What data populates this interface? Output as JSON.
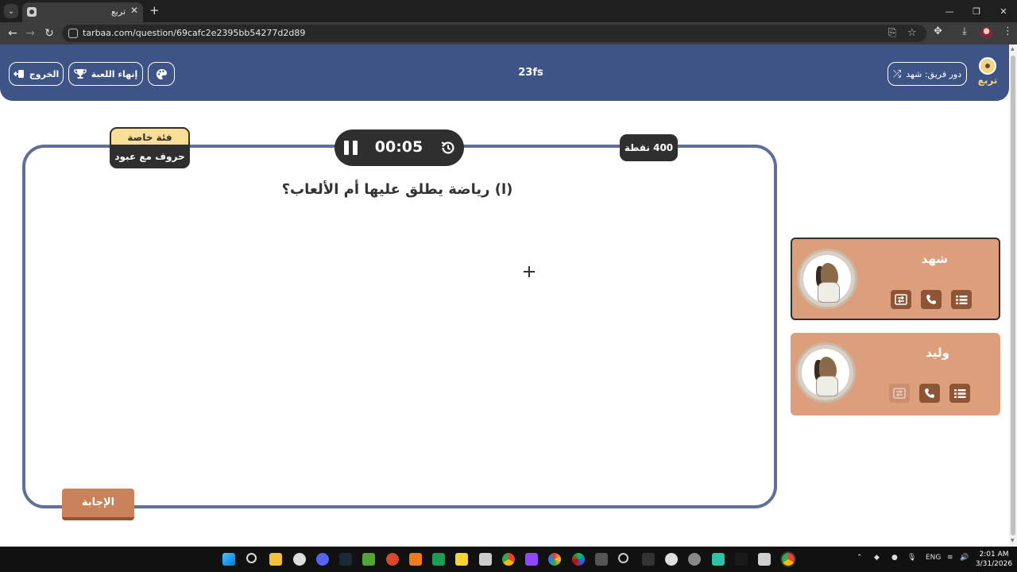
{
  "browser": {
    "tab_title": "تربع",
    "url": "tarbaa.com/question/69cafc2e2395bb54277d2d89"
  },
  "header": {
    "exit_label": "الخروج",
    "end_game_label": "إنهاء اللعبة",
    "game_name": "23fs",
    "turn_label": "دور فريق: شهد",
    "logo_text": "تربع"
  },
  "question": {
    "category_label": "فئة خاصة",
    "category_name": "حروف مع عبود",
    "timer": "00:05",
    "points": "400 نقطة",
    "text": "(ا) رياضة يطلق عليها أم الألعاب؟",
    "answer_label": "الإجابة"
  },
  "teams": [
    {
      "name": "شهد",
      "active": true
    },
    {
      "name": "وليد",
      "active": false
    }
  ],
  "taskbar": {
    "lang": "ENG",
    "time": "2:01 AM",
    "date": "3/31/2026"
  },
  "colors": {
    "header_bg": "#3e5386",
    "board_border": "#5d6f9a",
    "card_bg": "#dc9e7b",
    "tool_bg": "#8d5536",
    "dark": "#2f2f2f",
    "category_top": "#f8de97"
  }
}
